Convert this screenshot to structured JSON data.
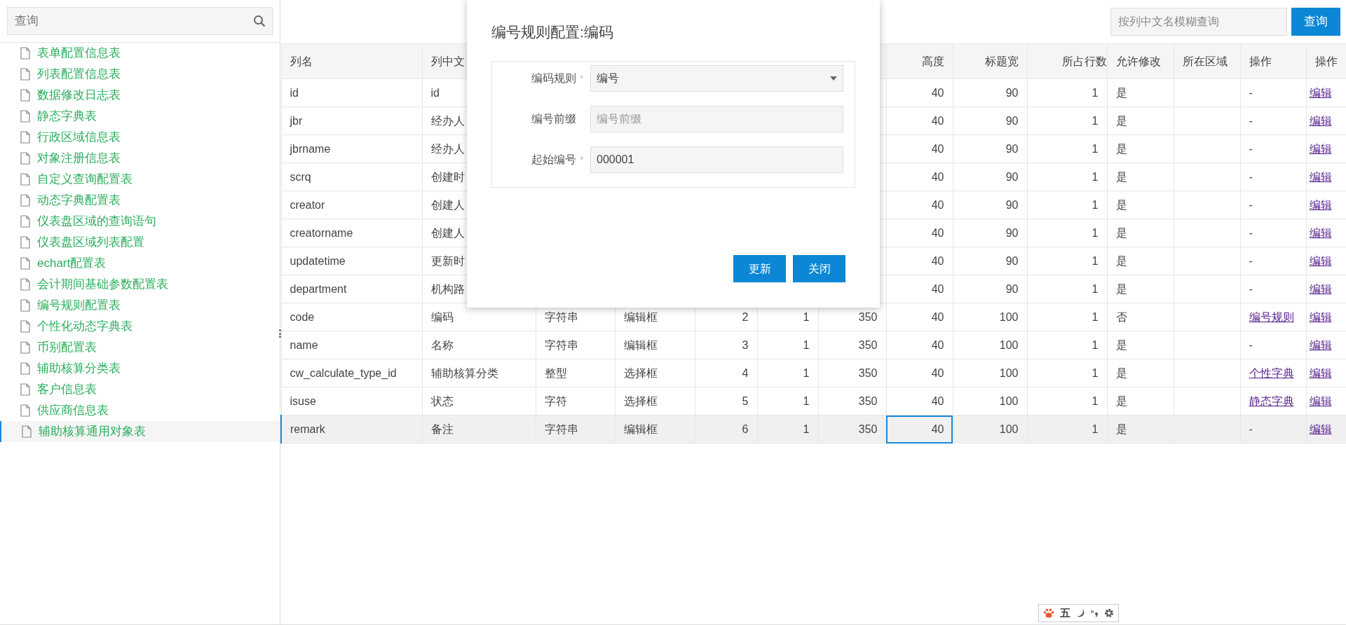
{
  "sidebar": {
    "search": {
      "placeholder": "查询"
    },
    "items": [
      {
        "label": "表单配置信息表",
        "selected": false
      },
      {
        "label": "列表配置信息表",
        "selected": false
      },
      {
        "label": "数据修改日志表",
        "selected": false
      },
      {
        "label": "静态字典表",
        "selected": false
      },
      {
        "label": "行政区域信息表",
        "selected": false
      },
      {
        "label": "对象注册信息表",
        "selected": false
      },
      {
        "label": "自定义查询配置表",
        "selected": false
      },
      {
        "label": "动态字典配置表",
        "selected": false
      },
      {
        "label": "仪表盘区域的查询语句",
        "selected": false
      },
      {
        "label": "仪表盘区域列表配置",
        "selected": false
      },
      {
        "label": "echart配置表",
        "selected": false
      },
      {
        "label": "会计期间基础参数配置表",
        "selected": false
      },
      {
        "label": "编号规则配置表",
        "selected": false
      },
      {
        "label": "个性化动态字典表",
        "selected": false
      },
      {
        "label": "币别配置表",
        "selected": false
      },
      {
        "label": "辅助核算分类表",
        "selected": false
      },
      {
        "label": "客户信息表",
        "selected": false
      },
      {
        "label": "供应商信息表",
        "selected": false
      },
      {
        "label": "辅助核算通用对象表",
        "selected": true
      }
    ]
  },
  "toolbar": {
    "search": {
      "placeholder": "按列中文名模糊查询"
    },
    "button": "查询"
  },
  "table": {
    "columns": [
      "列名",
      "列中文",
      null,
      null,
      null,
      null,
      null,
      "高度",
      "标题宽",
      "所占行数",
      "允许修改",
      "所在区域",
      "操作",
      "操作"
    ],
    "rows": [
      {
        "selected": false,
        "cells": [
          "id",
          "id",
          null,
          null,
          null,
          null,
          null,
          "40",
          "90",
          "1",
          "是",
          ""
        ],
        "action": {
          "kind": "text",
          "text": "-"
        },
        "edit": "编辑"
      },
      {
        "selected": false,
        "cells": [
          "jbr",
          "经办人",
          null,
          null,
          null,
          null,
          null,
          "40",
          "90",
          "1",
          "是",
          ""
        ],
        "action": {
          "kind": "text",
          "text": "-"
        },
        "edit": "编辑"
      },
      {
        "selected": false,
        "cells": [
          "jbrname",
          "经办人",
          null,
          null,
          null,
          null,
          null,
          "40",
          "90",
          "1",
          "是",
          ""
        ],
        "action": {
          "kind": "text",
          "text": "-"
        },
        "edit": "编辑"
      },
      {
        "selected": false,
        "cells": [
          "scrq",
          "创建时",
          null,
          null,
          null,
          null,
          null,
          "40",
          "90",
          "1",
          "是",
          ""
        ],
        "action": {
          "kind": "text",
          "text": "-"
        },
        "edit": "编辑"
      },
      {
        "selected": false,
        "cells": [
          "creator",
          "创建人",
          null,
          null,
          null,
          null,
          null,
          "40",
          "90",
          "1",
          "是",
          ""
        ],
        "action": {
          "kind": "text",
          "text": "-"
        },
        "edit": "编辑"
      },
      {
        "selected": false,
        "cells": [
          "creatorname",
          "创建人",
          null,
          null,
          null,
          null,
          null,
          "40",
          "90",
          "1",
          "是",
          ""
        ],
        "action": {
          "kind": "text",
          "text": "-"
        },
        "edit": "编辑"
      },
      {
        "selected": false,
        "cells": [
          "updatetime",
          "更新时",
          null,
          null,
          null,
          null,
          null,
          "40",
          "90",
          "1",
          "是",
          ""
        ],
        "action": {
          "kind": "text",
          "text": "-"
        },
        "edit": "编辑"
      },
      {
        "selected": false,
        "cells": [
          "department",
          "机构路",
          null,
          null,
          null,
          null,
          null,
          "40",
          "90",
          "1",
          "是",
          ""
        ],
        "action": {
          "kind": "text",
          "text": "-"
        },
        "edit": "编辑"
      },
      {
        "selected": false,
        "cells": [
          "code",
          "编码",
          "字符串",
          "编辑框",
          "2",
          "1",
          "350",
          "40",
          "100",
          "1",
          "否",
          ""
        ],
        "action": {
          "kind": "link",
          "text": "编号规则"
        },
        "edit": "编辑"
      },
      {
        "selected": false,
        "cells": [
          "name",
          "名称",
          "字符串",
          "编辑框",
          "3",
          "1",
          "350",
          "40",
          "100",
          "1",
          "是",
          ""
        ],
        "action": {
          "kind": "text",
          "text": "-"
        },
        "edit": "编辑"
      },
      {
        "selected": false,
        "cells": [
          "cw_calculate_type_id",
          "辅助核算分类",
          "整型",
          "选择框",
          "4",
          "1",
          "350",
          "40",
          "100",
          "1",
          "是",
          ""
        ],
        "action": {
          "kind": "link",
          "text": "个性字典"
        },
        "edit": "编辑"
      },
      {
        "selected": false,
        "cells": [
          "isuse",
          "状态",
          "字符",
          "选择框",
          "5",
          "1",
          "350",
          "40",
          "100",
          "1",
          "是",
          ""
        ],
        "action": {
          "kind": "link",
          "text": "静态字典"
        },
        "edit": "编辑"
      },
      {
        "selected": true,
        "cells": [
          "remark",
          "备注",
          "字符串",
          "编辑框",
          "6",
          "1",
          "350",
          {
            "text": "40",
            "focused": true
          },
          "100",
          "1",
          "是",
          ""
        ],
        "action": {
          "kind": "text",
          "text": "-"
        },
        "edit": "编辑"
      }
    ]
  },
  "dialog": {
    "title": "编号规则配置:编码",
    "fields": [
      {
        "kind": "select",
        "label": "编码规则",
        "required_mark": "*",
        "value": "编号"
      },
      {
        "kind": "input",
        "label": "编号前缀",
        "placeholder": "编号前缀"
      },
      {
        "kind": "input",
        "label": "起始编号",
        "required_mark": "*",
        "value": "000001"
      }
    ],
    "buttons": [
      "更新",
      "关闭"
    ]
  },
  "ime_toolbar": {
    "mode": "五"
  }
}
